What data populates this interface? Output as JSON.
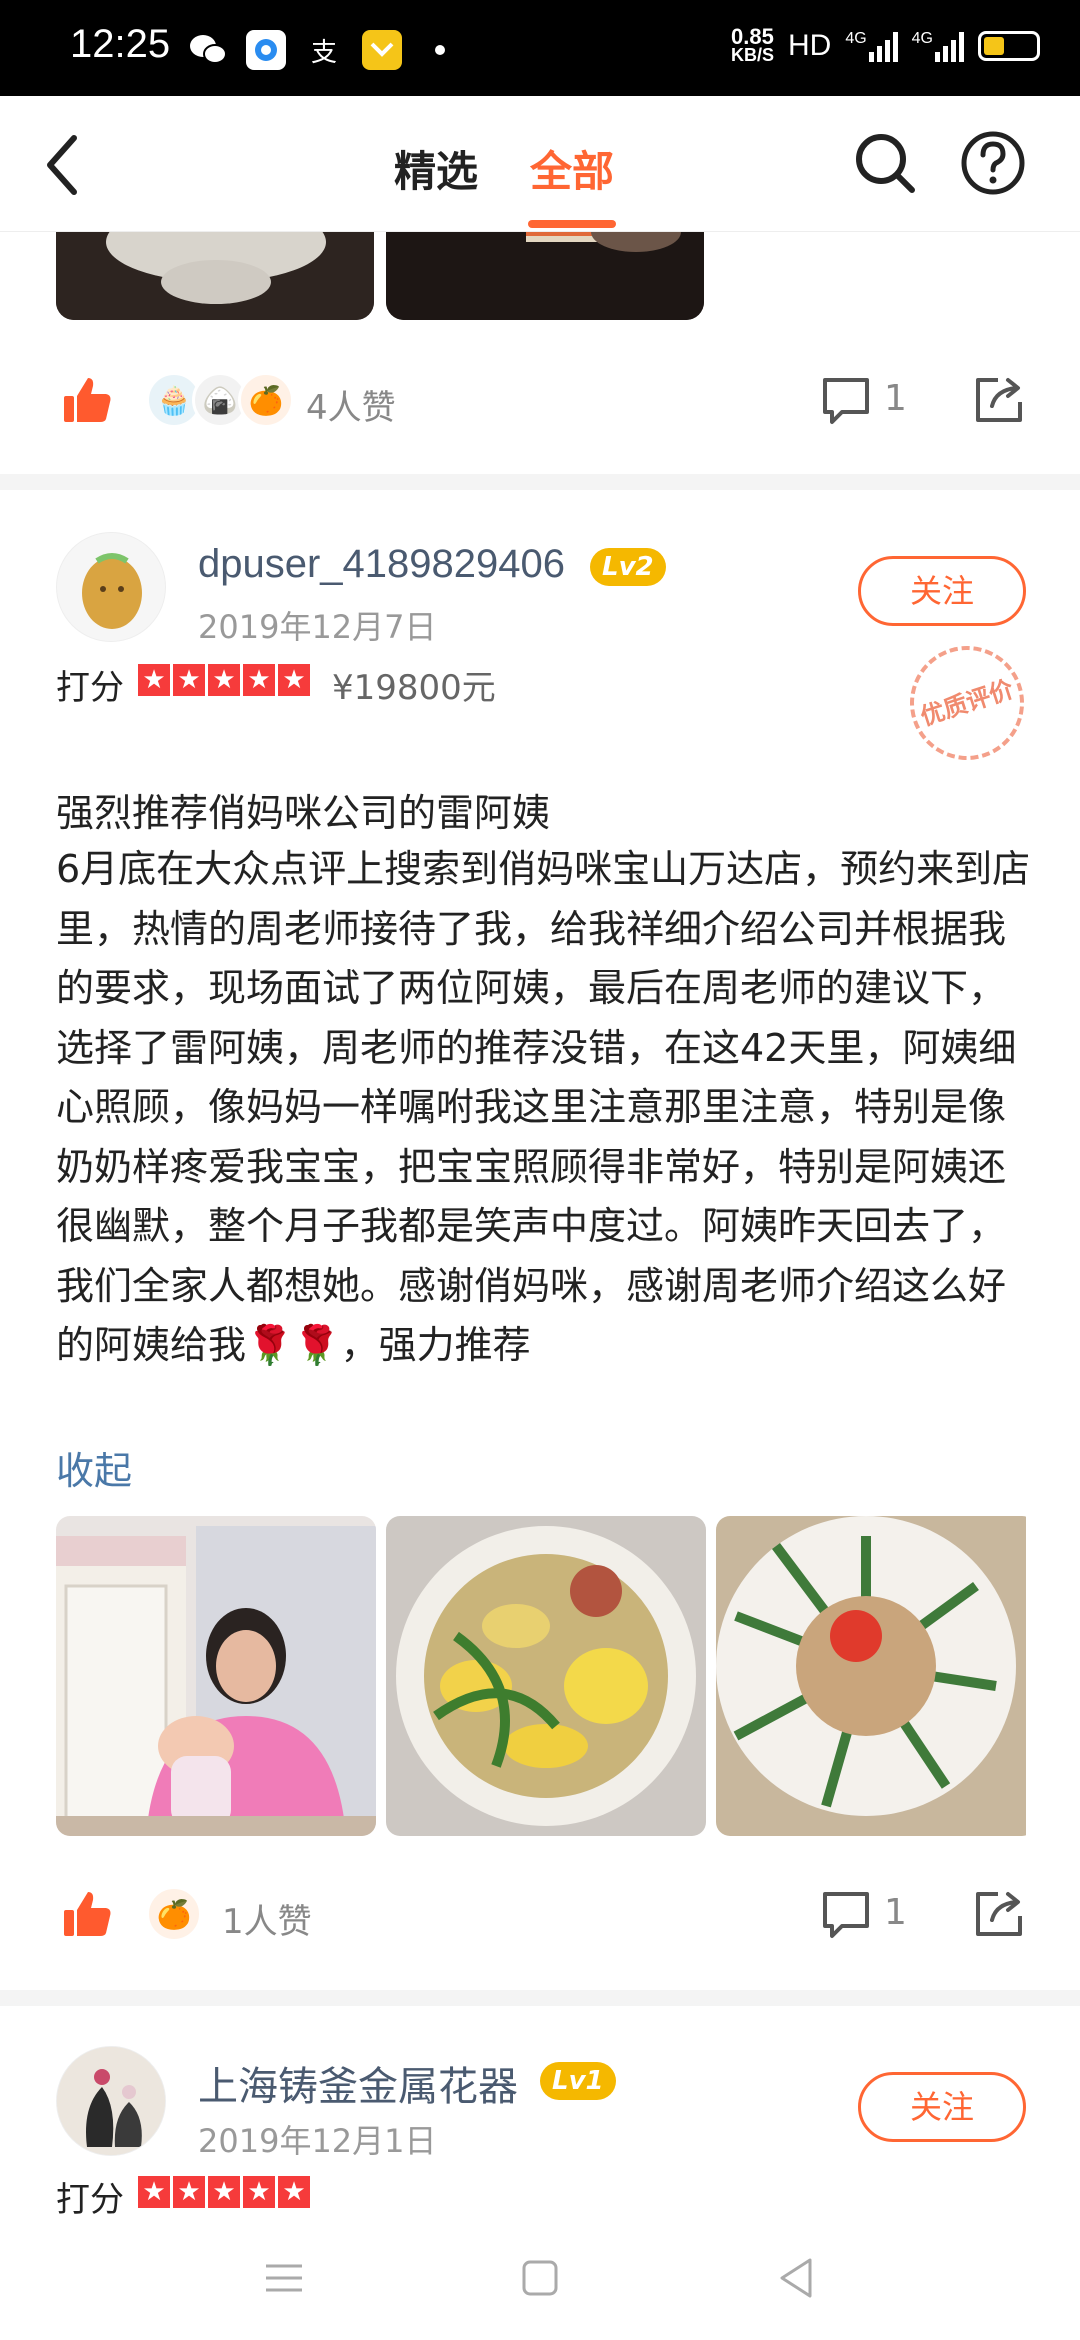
{
  "status_bar": {
    "time": "12:25",
    "net_speed_value": "0.85",
    "net_speed_unit": "KB/S",
    "hd_label": "HD",
    "signal1": "4G",
    "signal2": "4G",
    "icons": [
      "wechat-icon",
      "browser-icon",
      "alipay-icon",
      "coupon-icon"
    ]
  },
  "nav": {
    "tab_featured": "精选",
    "tab_all": "全部",
    "active_tab": "全部"
  },
  "prev_review": {
    "likes_text": "4人赞",
    "comment_count": "1"
  },
  "review": {
    "username": "dpuser_4189829406",
    "level": "Lv2",
    "date": "2019年12月7日",
    "follow_label": "关注",
    "rating_label": "打分",
    "stars": 5,
    "price": "¥19800元",
    "quality_stamp": "优质评价",
    "title": "强烈推荐俏妈咪公司的雷阿姨",
    "body": "6月底在大众点评上搜索到俏妈咪宝山万达店，预约来到店里，热情的周老师接待了我，给我祥细介绍公司并根据我的要求，现场面试了两位阿姨，最后在周老师的建议下，选择了雷阿姨，周老师的推荐没错，在这42天里，阿姨细心照顾，像妈妈一样嘱咐我这里注意那里注意，特别是像奶奶样疼爱我宝宝，把宝宝照顾得非常好，特别是阿姨还很幽默，整个月子我都是笑声中度过。阿姨昨天回去了，我们全家人都想她。感谢俏妈咪，感谢周老师介绍这么好的阿姨给我🌹🌹，强力推荐",
    "collapse_label": "收起",
    "likes_text": "1人赞",
    "comment_count": "1"
  },
  "next_review": {
    "username": "上海铸釜金属花器",
    "level": "Lv1",
    "date": "2019年12月1日",
    "follow_label": "关注",
    "rating_label": "打分",
    "stars": 5
  },
  "colors": {
    "accent": "#ff6633",
    "level_badge": "#f5b800",
    "star": "#f63b3b",
    "link": "#4a78a8"
  }
}
